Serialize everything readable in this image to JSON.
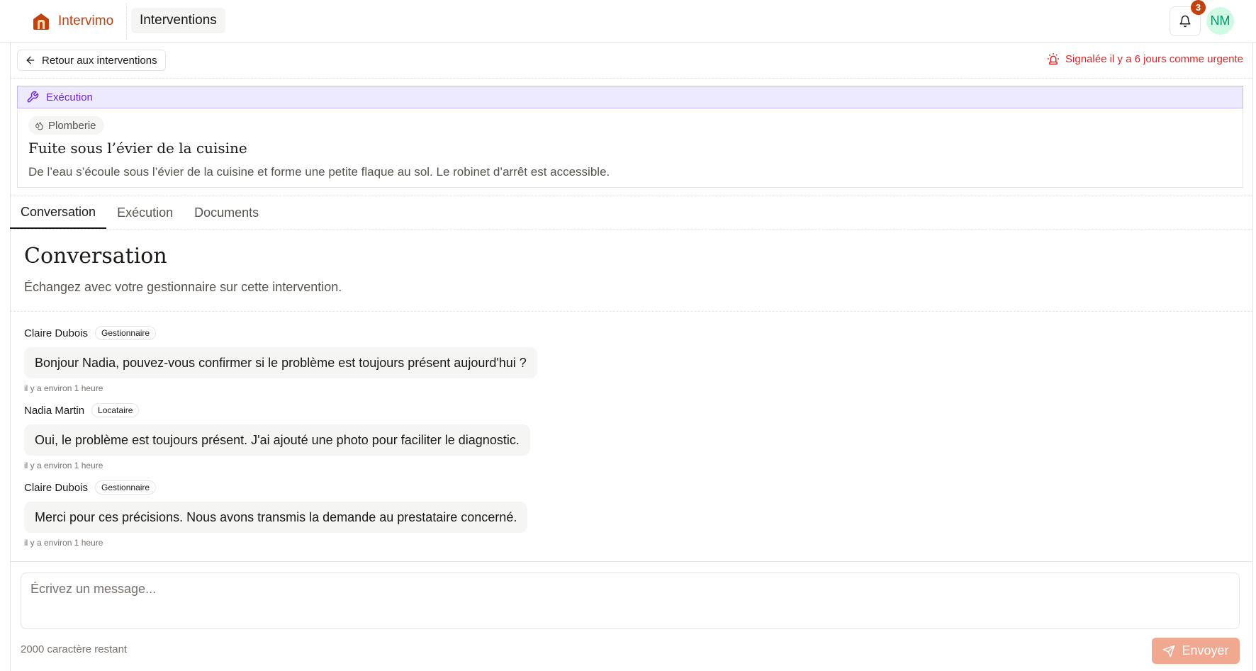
{
  "header": {
    "brand_name": "Intervimo",
    "nav_label": "Interventions",
    "notifications_count": "3",
    "avatar_initials": "NM",
    "brand_color": "#c2410c"
  },
  "toolbar": {
    "back_label": "Retour aux interventions",
    "urgent_label": "Signalée il y a 6 jours comme urgente",
    "urgent_color": "#dc2626"
  },
  "intervention": {
    "status_label": "Exécution",
    "status_color": "#6d28d9",
    "category": "Plomberie",
    "title": "Fuite sous l’évier de la cuisine",
    "description": "De l’eau s’écoule sous l’évier de la cuisine et forme une petite flaque au sol. Le robinet d’arrêt est accessible."
  },
  "tabs": [
    {
      "label": "Conversation",
      "active": true
    },
    {
      "label": "Exécution",
      "active": false
    },
    {
      "label": "Documents",
      "active": false
    }
  ],
  "conversation": {
    "title": "Conversation",
    "subtitle": "Échangez avec votre gestionnaire sur cette intervention.",
    "messages": [
      {
        "author": "Claire Dubois",
        "role": "Gestionnaire",
        "text": "Bonjour Nadia, pouvez-vous confirmer si le problème est toujours présent aujourd'hui ?",
        "time": "il y a environ 1 heure"
      },
      {
        "author": "Nadia Martin",
        "role": "Locataire",
        "text": "Oui, le problème est toujours présent. J'ai ajouté une photo pour faciliter le diagnostic.",
        "time": "il y a environ 1 heure"
      },
      {
        "author": "Claire Dubois",
        "role": "Gestionnaire",
        "text": "Merci pour ces précisions. Nous avons transmis la demande au prestataire concerné.",
        "time": "il y a environ 1 heure"
      }
    ]
  },
  "composer": {
    "placeholder": "Écrivez un message...",
    "value": "",
    "remaining": "2000 caractère restant",
    "send_label": "Envoyer"
  }
}
